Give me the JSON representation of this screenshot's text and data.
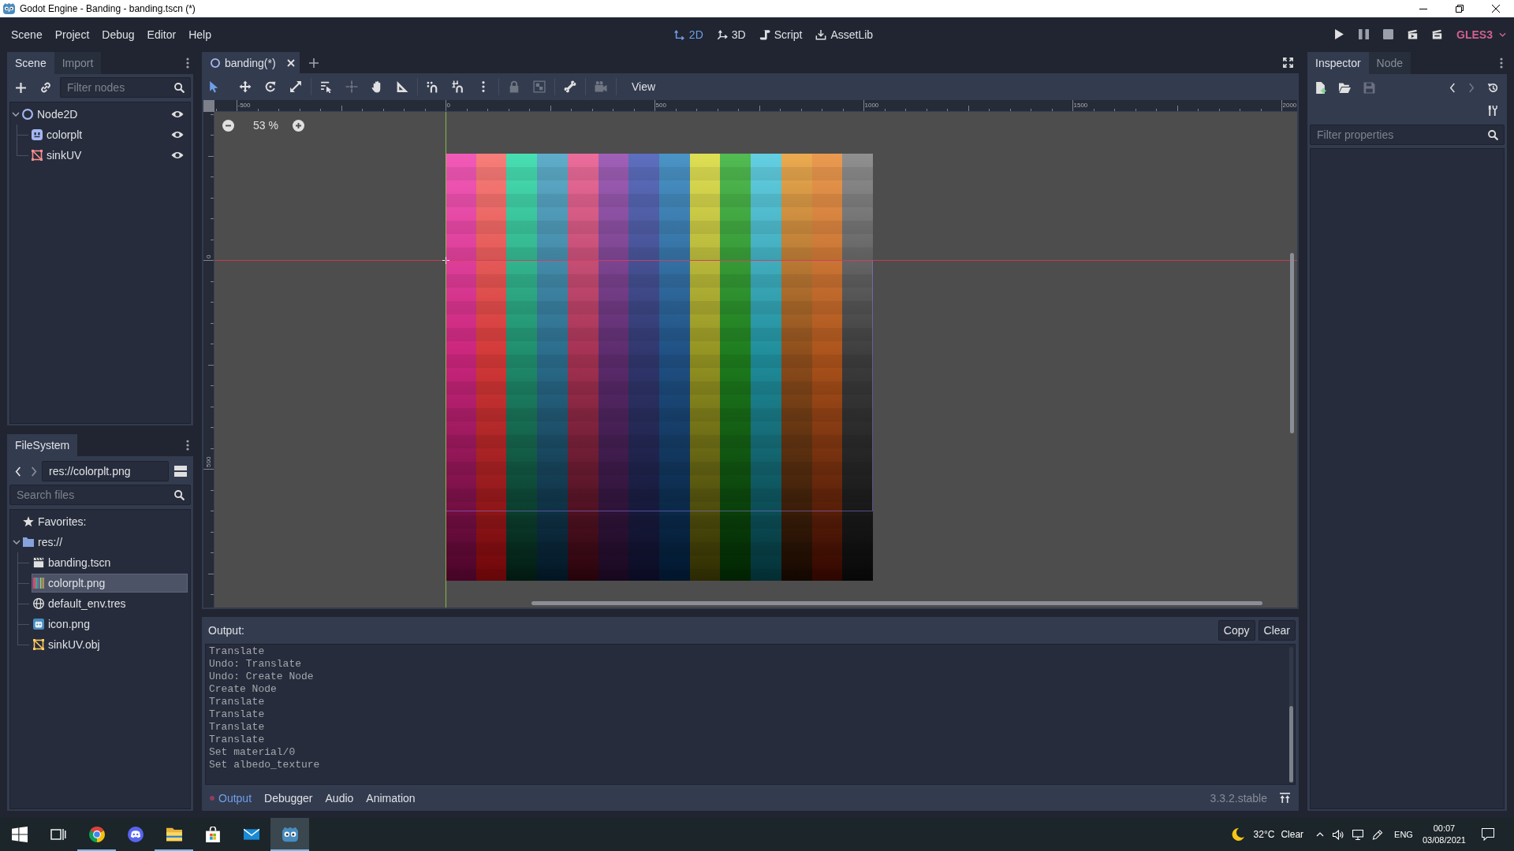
{
  "window": {
    "title": "Godot Engine - Banding - banding.tscn (*)"
  },
  "menu": [
    "Scene",
    "Project",
    "Debug",
    "Editor",
    "Help"
  ],
  "workspaces": [
    {
      "kind": "canvas",
      "label": "2D",
      "selected": true
    },
    {
      "kind": "spatial",
      "label": "3D",
      "selected": false
    },
    {
      "kind": "script",
      "label": "Script",
      "selected": false
    },
    {
      "kind": "library",
      "label": "AssetLib",
      "selected": false
    }
  ],
  "renderer": "GLES3",
  "scene_dock": {
    "tabs": [
      {
        "label": "Scene",
        "selected": true
      },
      {
        "label": "Import",
        "selected": false
      }
    ],
    "filter": {
      "placeholder": "Filter nodes"
    },
    "tree": [
      {
        "name": "Node2D",
        "kind": "node2d",
        "visible": true,
        "expanded": true,
        "children": [
          {
            "name": "colorplt",
            "kind": "sprite",
            "visible": true
          },
          {
            "name": "sinkUV",
            "kind": "mesh",
            "visible": true
          }
        ]
      }
    ]
  },
  "filesystem_dock": {
    "tabs": [
      {
        "label": "FileSystem",
        "selected": true
      }
    ],
    "path": "res://colorplt.png",
    "search": {
      "placeholder": "Search files"
    },
    "tree": [
      {
        "name": "Favorites:",
        "kind": "favorites",
        "selected": false
      },
      {
        "name": "res://",
        "kind": "folder",
        "selected": false,
        "expanded": true,
        "children": [
          {
            "name": "banding.tscn",
            "kind": "scene",
            "selected": false
          },
          {
            "name": "colorplt.png",
            "kind": "texture",
            "selected": true
          },
          {
            "name": "default_env.tres",
            "kind": "environment",
            "selected": false
          },
          {
            "name": "icon.png",
            "kind": "logo",
            "selected": false
          },
          {
            "name": "sinkUV.obj",
            "kind": "mesh",
            "selected": false
          }
        ]
      }
    ]
  },
  "editor": {
    "tabs": [
      {
        "label": "banding(*)",
        "selected": true
      }
    ],
    "tools": [
      [
        {
          "kind": "select",
          "selected": true,
          "disabled": false
        },
        {
          "kind": "move",
          "selected": false,
          "disabled": false
        },
        {
          "kind": "rotate",
          "selected": false,
          "disabled": false
        },
        {
          "kind": "scale",
          "selected": false,
          "disabled": false
        }
      ],
      [
        {
          "kind": "listselect",
          "selected": false,
          "disabled": false
        },
        {
          "kind": "pivot",
          "selected": false,
          "disabled": true
        },
        {
          "kind": "pan",
          "selected": false,
          "disabled": false
        },
        {
          "kind": "ruler",
          "selected": false,
          "disabled": false
        }
      ],
      [
        {
          "kind": "smartsnap",
          "selected": false,
          "disabled": false
        },
        {
          "kind": "gridsnap",
          "selected": false,
          "disabled": false
        },
        {
          "kind": "more",
          "selected": false,
          "disabled": false
        }
      ],
      [
        {
          "kind": "lock",
          "selected": false,
          "disabled": true
        },
        {
          "kind": "group",
          "selected": false,
          "disabled": true
        }
      ],
      [
        {
          "kind": "bone",
          "selected": false,
          "disabled": false
        }
      ],
      [
        {
          "kind": "camera",
          "selected": false,
          "disabled": true
        }
      ]
    ],
    "view_menu": "View",
    "zoom": "53 %",
    "ruler": {
      "x_labels": [
        "-500",
        "0",
        "500",
        "1000",
        "1500",
        "2000"
      ],
      "y_labels": [
        "0",
        "500"
      ]
    }
  },
  "output": {
    "title": "Output:",
    "buttons": [
      "Copy",
      "Clear"
    ],
    "lines": [
      "Translate",
      "Undo: Translate",
      "Undo: Create Node",
      "Create Node",
      "Translate",
      "Translate",
      "Translate",
      "Translate",
      "Set material/0",
      "Set albedo_texture"
    ],
    "tabs": [
      {
        "label": "Output",
        "selected": true,
        "indicator": true
      },
      {
        "label": "Debugger",
        "selected": false,
        "indicator": false
      },
      {
        "label": "Audio",
        "selected": false,
        "indicator": false
      },
      {
        "label": "Animation",
        "selected": false,
        "indicator": false
      }
    ],
    "version": "3.3.2.stable"
  },
  "inspector": {
    "tabs": [
      {
        "label": "Inspector",
        "selected": true
      },
      {
        "label": "Node",
        "selected": false
      }
    ],
    "actions": [
      {
        "kind": "new",
        "disabled": false
      },
      {
        "kind": "open",
        "disabled": false
      },
      {
        "kind": "save",
        "disabled": true
      }
    ],
    "history": [
      {
        "kind": "back",
        "disabled": false
      },
      {
        "kind": "forward",
        "disabled": true
      }
    ],
    "filter": {
      "placeholder": "Filter properties"
    }
  },
  "taskbar": {
    "apps": [
      {
        "kind": "browser",
        "running": true,
        "selected": false
      },
      {
        "kind": "chat",
        "running": false,
        "selected": false
      },
      {
        "kind": "files",
        "running": true,
        "selected": false
      },
      {
        "kind": "store",
        "running": false,
        "selected": false
      },
      {
        "kind": "mail",
        "running": false,
        "selected": false
      },
      {
        "kind": "engine",
        "running": true,
        "selected": true
      }
    ],
    "weather": {
      "temperature": "32°C",
      "condition": "Clear"
    },
    "language": "ENG",
    "time": "00:07",
    "date": "03/08/2021"
  }
}
